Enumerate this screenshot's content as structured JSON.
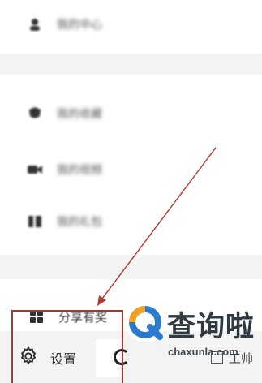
{
  "menu": {
    "top_item": {
      "label": "我的中心",
      "icon": "user-icon"
    },
    "middle_items": [
      {
        "label": "我的收藏",
        "icon": "shield-icon"
      },
      {
        "label": "我的视频",
        "icon": "video-icon"
      },
      {
        "label": "我的礼包",
        "icon": "gift-icon"
      }
    ],
    "share_item": {
      "label": "分享有奖",
      "icon": "grid-icon"
    },
    "settings_item": {
      "label": "设置",
      "icon": "gear-icon"
    },
    "right_cut_label": "工帅"
  },
  "watermark": {
    "title": "查询啦",
    "url": "chaxunla.com",
    "colors": {
      "orange": "#f0a31c",
      "blue": "#2a7bd0"
    }
  },
  "annotation": {
    "color": "#a33a32"
  }
}
